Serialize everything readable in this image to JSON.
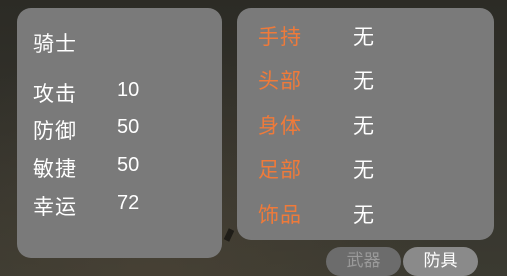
{
  "character": {
    "name": "骑士",
    "stats": [
      {
        "label": "攻击",
        "value": "10"
      },
      {
        "label": "防御",
        "value": "50"
      },
      {
        "label": "敏捷",
        "value": "50"
      },
      {
        "label": "幸运",
        "value": "72"
      }
    ]
  },
  "equipment": {
    "slots": [
      {
        "slot": "手持",
        "value": "无"
      },
      {
        "slot": "头部",
        "value": "无"
      },
      {
        "slot": "身体",
        "value": "无"
      },
      {
        "slot": "足部",
        "value": "无"
      },
      {
        "slot": "饰品",
        "value": "无"
      }
    ]
  },
  "tabs": {
    "weapon": "武器",
    "armor": "防具",
    "selected": "防具"
  },
  "colors": {
    "panel": "#7a7a7a",
    "slot_label": "#ef7a3a",
    "text": "#ffffff"
  }
}
